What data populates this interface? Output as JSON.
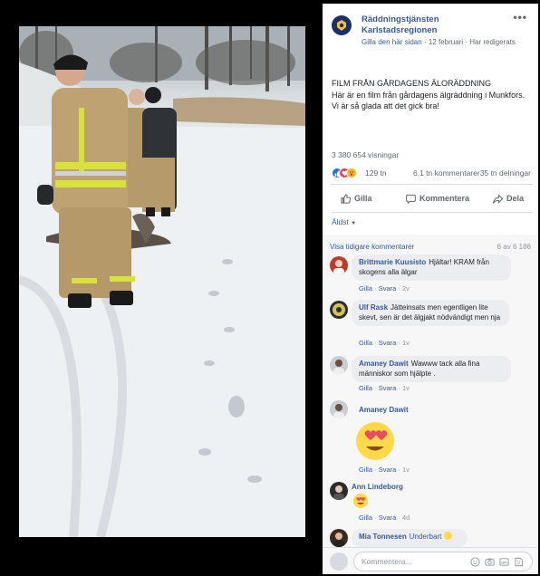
{
  "post": {
    "page_name": "Räddningstjänsten Karlstadsregionen",
    "like_page": "Gilla den här sidan",
    "date": "12 februari",
    "edited": "Har redigerats",
    "more": "•••",
    "title": "FILM FRÅN GÅRDAGENS ÄLORÄDDNING",
    "body": "Här är en film från gårdagens älgräddning i Munkfors. Vi är så glada att det gick bra!",
    "views": "3 380 654 visningar",
    "reaction_count": "129 tn",
    "comment_count": "6,1 tn kommentarer",
    "share_count": "35 tn delningar",
    "reaction_colors": {
      "like": "#1877f2",
      "love": "#f33e58",
      "wow": "#f7b125"
    }
  },
  "actions": {
    "like": "Gilla",
    "comment": "Kommentera",
    "share": "Dela"
  },
  "comments_header": {
    "sort": "Äldst",
    "previous": "Visa tidigare kommentarer",
    "count": "6 av 6 186"
  },
  "comments": [
    {
      "name": "Brittmarie Kuusisto",
      "text": "Hjältar! KRAM från skogens alla älgar",
      "like": "Gilla",
      "reply": "Svara",
      "time": "2v"
    },
    {
      "name": "Ulf Rask",
      "text": "Jätteinsats men egentligen lite skevt, sen är det älgjakt nödvändigt men nja",
      "like": "Gilla",
      "reply": "Svara",
      "time": "1v"
    },
    {
      "name": "Amaney Dawit",
      "text": "Wawww tack alla fina människor som hjälpte .",
      "like": "Gilla",
      "reply": "Svara",
      "time": "1v"
    },
    {
      "name": "Amaney Dawit",
      "text": "",
      "like": "Gilla",
      "reply": "Svara",
      "time": "1v"
    },
    {
      "name": "Ann Lindeborg",
      "text": "",
      "like": "Gilla",
      "reply": "Svara",
      "time": "4d"
    },
    {
      "name": "Mia Tonnesen",
      "text": "Underbart",
      "like": "",
      "reply": "",
      "time": ""
    }
  ],
  "compose": {
    "placeholder": "Kommentera..."
  }
}
